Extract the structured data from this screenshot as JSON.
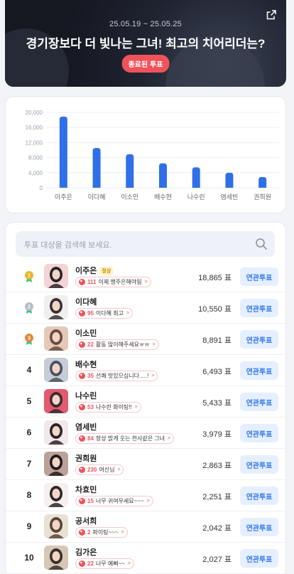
{
  "event": {
    "date_range": "25.05.19 ~ 25.05.25",
    "title": "경기장보다 더 빛나는 그녀! 최고의 치어리더는?",
    "status": "종료된 투표"
  },
  "chart_data": {
    "type": "bar",
    "categories": [
      "이주은",
      "이다혜",
      "이소민",
      "배수현",
      "나수린",
      "염세빈",
      "권희원"
    ],
    "values": [
      18865,
      10550,
      8891,
      6493,
      5433,
      3979,
      2863
    ],
    "y_ticks": [
      "0",
      "4,000",
      "8,000",
      "12,000",
      "16,000",
      "20,000"
    ],
    "ylim": [
      0,
      20000
    ],
    "grid": true,
    "color": "#2f6fe8"
  },
  "search": {
    "placeholder": "투표 대상을 검색해 보세요."
  },
  "vote_button_label": "연관투표",
  "votes_unit": "표",
  "colors": {
    "accent": "#3478ef",
    "status": "#f0525a",
    "gold": "#e9b72e",
    "silver": "#b8bec8",
    "bronze": "#e08a3a"
  },
  "rows": [
    {
      "rank": "1",
      "medal": "gold",
      "name": "이주은",
      "badge": "정상",
      "cheer_count": "111",
      "cheer_text": "이제 맹주은해야됨",
      "votes": "18,865"
    },
    {
      "rank": "2",
      "medal": "silver",
      "name": "이다혜",
      "badge": "",
      "cheer_count": "95",
      "cheer_text": "이다혜 최고",
      "votes": "10,550"
    },
    {
      "rank": "3",
      "medal": "bronze",
      "name": "이소민",
      "badge": "",
      "cheer_count": "22",
      "cheer_text": "활동 많이해주세요ㅠㅠ",
      "votes": "8,891"
    },
    {
      "rank": "4",
      "medal": "",
      "name": "배수현",
      "badge": "",
      "cheer_count": "35",
      "cheer_text": "선쾌 맛있으십니다.....!",
      "votes": "6,493"
    },
    {
      "rank": "5",
      "medal": "",
      "name": "나수린",
      "badge": "",
      "cheer_count": "53",
      "cheer_text": "나수린 화이팅!!",
      "votes": "5,433"
    },
    {
      "rank": "6",
      "medal": "",
      "name": "염세빈",
      "badge": "",
      "cheer_count": "84",
      "cheer_text": "항상 밝게 웃는 천사같은 그녀",
      "votes": "3,979"
    },
    {
      "rank": "7",
      "medal": "",
      "name": "권희원",
      "badge": "",
      "cheer_count": "230",
      "cheer_text": "여신님",
      "votes": "2,863"
    },
    {
      "rank": "8",
      "medal": "",
      "name": "차효민",
      "badge": "",
      "cheer_count": "15",
      "cheer_text": "너무 귀여우세요~~~",
      "votes": "2,251"
    },
    {
      "rank": "9",
      "medal": "",
      "name": "공서희",
      "badge": "",
      "cheer_count": "2",
      "cheer_text": "파이팅~~~",
      "votes": "2,042"
    },
    {
      "rank": "10",
      "medal": "",
      "name": "김가은",
      "badge": "",
      "cheer_count": "22",
      "cheer_text": "너무 예뻐~~",
      "votes": "2,027"
    }
  ]
}
